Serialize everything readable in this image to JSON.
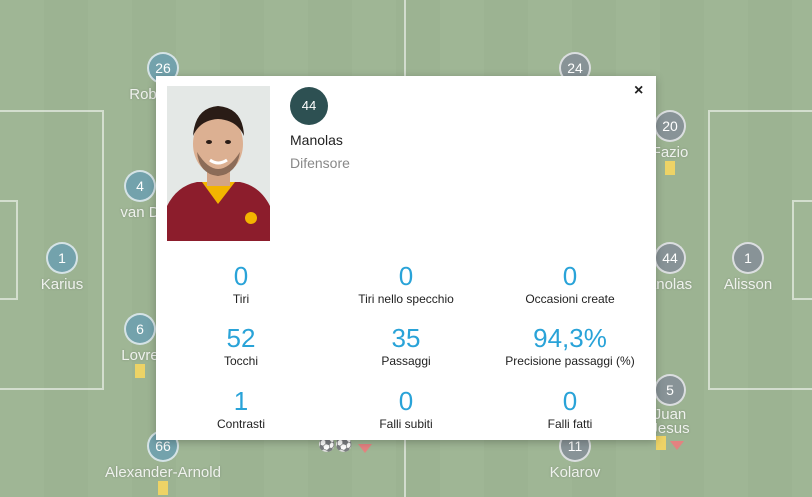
{
  "pitch": {
    "home_players": [
      {
        "number": "26",
        "name": "Rob"
      },
      {
        "number": "4",
        "name": "van D"
      },
      {
        "number": "1",
        "name": "Karius"
      },
      {
        "number": "6",
        "name": "Lovre"
      },
      {
        "number": "66",
        "name": "Alexander-Arnold"
      }
    ],
    "away_players": [
      {
        "number": "24",
        "name": ""
      },
      {
        "number": "20",
        "name": "Fazio"
      },
      {
        "number": "44",
        "name": "anolas"
      },
      {
        "number": "1",
        "name": "Alisson"
      },
      {
        "number": "5",
        "name": "Juan Jesus"
      },
      {
        "number": "11",
        "name": "Kolarov"
      }
    ]
  },
  "modal": {
    "close_label": "×",
    "player_number": "44",
    "player_name": "Manolas",
    "player_role": "Difensore",
    "stats": [
      {
        "value": "0",
        "label": "Tiri"
      },
      {
        "value": "0",
        "label": "Tiri nello specchio"
      },
      {
        "value": "0",
        "label": "Occasioni create"
      },
      {
        "value": "52",
        "label": "Tocchi"
      },
      {
        "value": "35",
        "label": "Passaggi"
      },
      {
        "value": "94,3%",
        "label": "Precisione passaggi (%)"
      },
      {
        "value": "1",
        "label": "Contrasti"
      },
      {
        "value": "0",
        "label": "Falli subiti"
      },
      {
        "value": "0",
        "label": "Falli fatti"
      }
    ]
  },
  "colors": {
    "accent": "#29a3d8",
    "badge": "#2d5052",
    "home_chip": "#3d7f8c",
    "away_chip": "#5b6a6f"
  }
}
